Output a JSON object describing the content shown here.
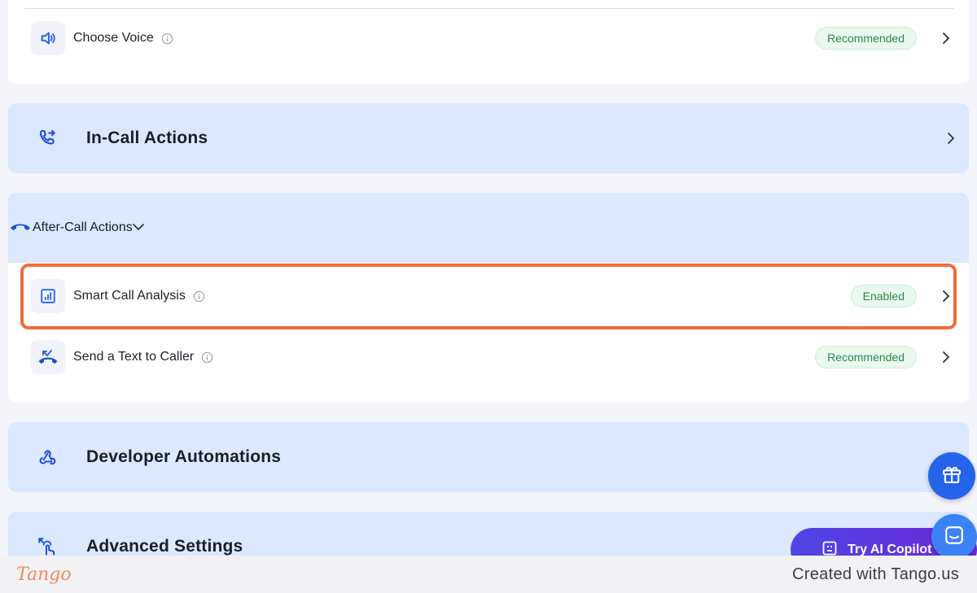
{
  "voice_card": {
    "item": {
      "label": "Choose Voice",
      "badge": "Recommended",
      "icon": "speaker-icon"
    }
  },
  "sections": {
    "in_call": {
      "title": "In-Call Actions",
      "icon": "phone-forward-icon"
    },
    "after_call": {
      "title": "After-Call Actions",
      "icon": "hang-up-icon",
      "items": [
        {
          "label": "Smart Call Analysis",
          "badge": "Enabled",
          "icon": "analytics-icon"
        },
        {
          "label": "Send a Text to Caller",
          "badge": "Recommended",
          "icon": "missed-call-icon"
        }
      ]
    },
    "developer": {
      "title": "Developer Automations",
      "icon": "webhook-icon"
    },
    "advanced": {
      "title": "Advanced Settings",
      "icon": "touch-gesture-icon"
    }
  },
  "floating": {
    "copilot_label": "Try AI Copilot"
  },
  "footer": {
    "logo": "Tango",
    "credit": "Created with Tango.us"
  },
  "colors": {
    "accent": "#2563eb",
    "section_bg": "#dbe8fd",
    "badge_green": "#2c8a47",
    "highlight": "#f26b3a"
  }
}
